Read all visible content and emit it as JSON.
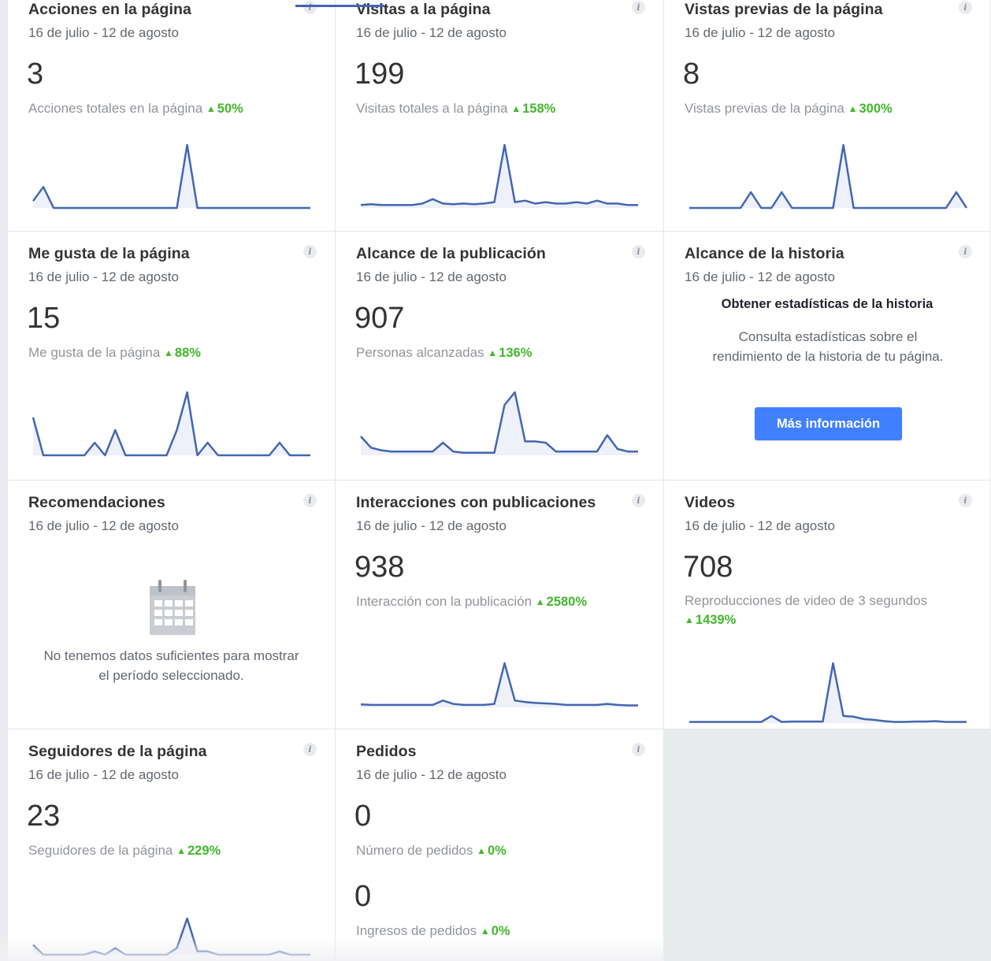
{
  "date_range": "16 de julio - 12 de agosto",
  "colors": {
    "line": "#4267b2",
    "fill": "#eef0fa",
    "increase": "#42b72a",
    "button": "#4080ff"
  },
  "cards": {
    "page_actions": {
      "title": "Acciones en la página",
      "date": "16 de julio - 12 de agosto",
      "value": "3",
      "metric_label": "Acciones totales en la página",
      "change": "50%",
      "trend": [
        0.33,
        1,
        0,
        0,
        0,
        0,
        0,
        0,
        0,
        0,
        0,
        0,
        0,
        0,
        0,
        3,
        0,
        0,
        0,
        0,
        0,
        0,
        0,
        0,
        0,
        0,
        0,
        0
      ]
    },
    "page_visits": {
      "title": "Visitas a la página",
      "date": "16 de julio - 12 de agosto",
      "value": "199",
      "metric_label": "Visitas totales a la página",
      "change": "158%",
      "trend": [
        2,
        2.5,
        2,
        2,
        2,
        2,
        3,
        6,
        3,
        2.5,
        3,
        2.5,
        3,
        4,
        43,
        4,
        5,
        3,
        4,
        3,
        3,
        4,
        3,
        5,
        3,
        3,
        2,
        2
      ]
    },
    "page_previews": {
      "title": "Vistas previas de la página",
      "date": "16 de julio - 12 de agosto",
      "value": "8",
      "metric_label": "Vistas previas de la página",
      "change": "300%",
      "trend": [
        0,
        0,
        0,
        0,
        0,
        0,
        1,
        0,
        0,
        1,
        0,
        0,
        0,
        0,
        0,
        4,
        0,
        0,
        0,
        0,
        0,
        0,
        0,
        0,
        0,
        0,
        1,
        0
      ]
    },
    "page_likes": {
      "title": "Me gusta de la página",
      "date": "16 de julio - 12 de agosto",
      "value": "15",
      "metric_label": "Me gusta de la página",
      "change": "88%",
      "trend": [
        3,
        0,
        0,
        0,
        0,
        0,
        1,
        0,
        2,
        0,
        0,
        0,
        0,
        0,
        2,
        5,
        0,
        1,
        0,
        0,
        0,
        0,
        0,
        0,
        1,
        0,
        0,
        0
      ]
    },
    "post_reach": {
      "title": "Alcance de la publicación",
      "date": "16 de julio - 12 de agosto",
      "value": "907",
      "metric_label": "Personas alcanzadas",
      "change": "136%",
      "trend": [
        15,
        6,
        4,
        3,
        3,
        3,
        3,
        3,
        10,
        3,
        2,
        2,
        2,
        2,
        40,
        50,
        11,
        11,
        10,
        3,
        3,
        3,
        3,
        3,
        16,
        5,
        3,
        3
      ]
    },
    "story_reach": {
      "title": "Alcance de la historia",
      "date": "16 de julio - 12 de agosto",
      "heading": "Obtener estadísticas de la historia",
      "description": "Consulta estadísticas sobre el rendimiento de la historia de tu página.",
      "button_label": "Más información"
    },
    "recommendations": {
      "title": "Recomendaciones",
      "date": "16 de julio - 12 de agosto",
      "empty_message": "No tenemos datos suficientes para mostrar el período seleccionado.",
      "icon": "calendar-icon"
    },
    "post_engagement": {
      "title": "Interacciones con publicaciones",
      "date": "16 de julio - 12 de agosto",
      "value": "938",
      "metric_label": "Interacción con la publicación",
      "change": "2580%",
      "trend": [
        3,
        2.5,
        2.5,
        2.5,
        2.5,
        2.5,
        2.5,
        2.5,
        7,
        3.5,
        2.5,
        2.5,
        2.5,
        3.5,
        45,
        7,
        5.5,
        4.5,
        4,
        3.5,
        2.5,
        2.5,
        2.5,
        2.5,
        3.5,
        2.5,
        2,
        2
      ]
    },
    "videos": {
      "title": "Videos",
      "date": "16 de julio - 12 de agosto",
      "value": "708",
      "metric_label": "Reproducciones de video de 3 segundos",
      "change": "1439%",
      "trend": [
        1.5,
        1.5,
        1.5,
        1.5,
        1.5,
        1.5,
        1.5,
        1.5,
        9,
        1.5,
        2,
        2,
        2,
        2,
        75,
        9,
        8,
        5,
        4,
        2.5,
        1.5,
        1.5,
        2,
        2,
        2.5,
        1.5,
        1.5,
        1.5
      ]
    },
    "page_followers": {
      "title": "Seguidores de la página",
      "date": "16 de julio - 12 de agosto",
      "value": "23",
      "metric_label": "Seguidores de la página",
      "change": "229%",
      "trend": [
        3,
        0,
        0,
        0,
        0,
        0,
        1,
        0,
        2,
        0,
        0,
        0,
        0,
        0,
        2,
        11,
        1,
        1,
        0,
        0,
        0,
        0,
        0,
        0,
        1,
        0,
        0,
        0
      ]
    },
    "orders": {
      "title": "Pedidos",
      "date": "16 de julio - 12 de agosto",
      "value": "0",
      "metric_label": "Número de pedidos",
      "change": "0%",
      "value2": "0",
      "metric_label2": "Ingresos de pedidos",
      "change2": "0%"
    }
  }
}
